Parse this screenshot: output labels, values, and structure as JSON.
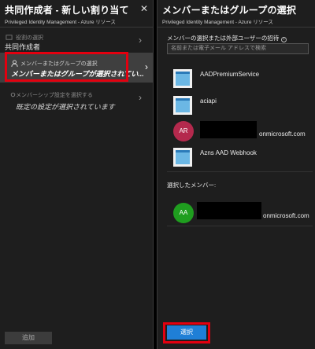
{
  "left": {
    "title": "共同作成者 - 新しい割り当て",
    "subtitle": "Privileged Identity Management - Azure リソース",
    "steps": [
      {
        "small": "役割の選択",
        "big": "共同作成者"
      },
      {
        "small": "メンバーまたはグループの選択",
        "big": "メンバーまたはグループが選択されてい..."
      },
      {
        "small": "メンバーシップ設定を選択する",
        "big": "既定の設定が選択されています"
      }
    ],
    "add_label": "追加"
  },
  "right": {
    "title": "メンバーまたはグループの選択",
    "subtitle": "Privileged Identity Management - Azure リソース",
    "search_label": "メンバーの選択または外部ユーザーの招待",
    "search_placeholder": "名前または電子メール アドレスで検索",
    "results": [
      {
        "kind": "app",
        "name": "AADPremiumService"
      },
      {
        "kind": "app",
        "name": "aciapi"
      },
      {
        "kind": "user",
        "initials": "AR",
        "avatar_color": "#b4294d",
        "suffix": "onmicrosoft.com"
      },
      {
        "kind": "app",
        "name": "Azns AAD Webhook"
      }
    ],
    "selected_label": "選択したメンバー:",
    "selected": [
      {
        "initials": "AA",
        "avatar_color": "#1f9e1f",
        "suffix": "onmicrosoft.com"
      }
    ],
    "select_label": "選択"
  }
}
